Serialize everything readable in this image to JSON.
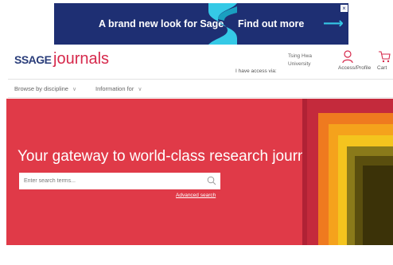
{
  "ad": {
    "left_text": "A brand new look for Sage",
    "right_text": "Find out more",
    "arrow": "⟶",
    "close": "×",
    "icon": "sage-s-logo-icon"
  },
  "header": {
    "logo_sage": "SSAGE",
    "logo_journals": "journals",
    "access_label": "I have access via:",
    "institution": "Tsing Hwa University",
    "profile_label": "Access/Profile",
    "cart_label": "Cart"
  },
  "nav": {
    "items": [
      {
        "label": "Browse by discipline",
        "icon": "chevron-down-icon"
      },
      {
        "label": "Information for",
        "icon": "chevron-down-icon"
      }
    ]
  },
  "hero": {
    "title": "Your gateway to world-class research journals",
    "search_placeholder": "Enter search terms...",
    "advanced_search": "Advanced search"
  },
  "colors": {
    "ad_background": "#1e2f73",
    "ad_accent": "#35c9e6",
    "brand_red": "#d6284b",
    "hero_background": "#e03a48",
    "logo_blue": "#2a3d7a"
  }
}
